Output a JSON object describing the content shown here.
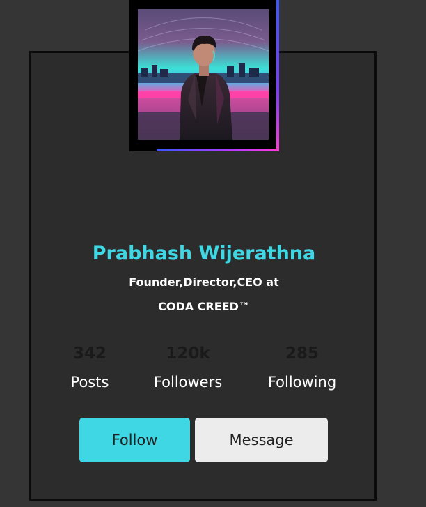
{
  "profile": {
    "name": "Prabhash Wijerathna",
    "title_line1": "Founder,Director,CEO at",
    "title_line2": "CODA CREED™"
  },
  "stats": [
    {
      "value": "342",
      "label": "Posts"
    },
    {
      "value": "120k",
      "label": "Followers"
    },
    {
      "value": "285",
      "label": "Following"
    }
  ],
  "buttons": {
    "follow": "Follow",
    "message": "Message"
  },
  "colors": {
    "accent": "#3fd7e3",
    "background": "#353535",
    "card": "#2c2c2c",
    "message_button": "#ececec"
  }
}
